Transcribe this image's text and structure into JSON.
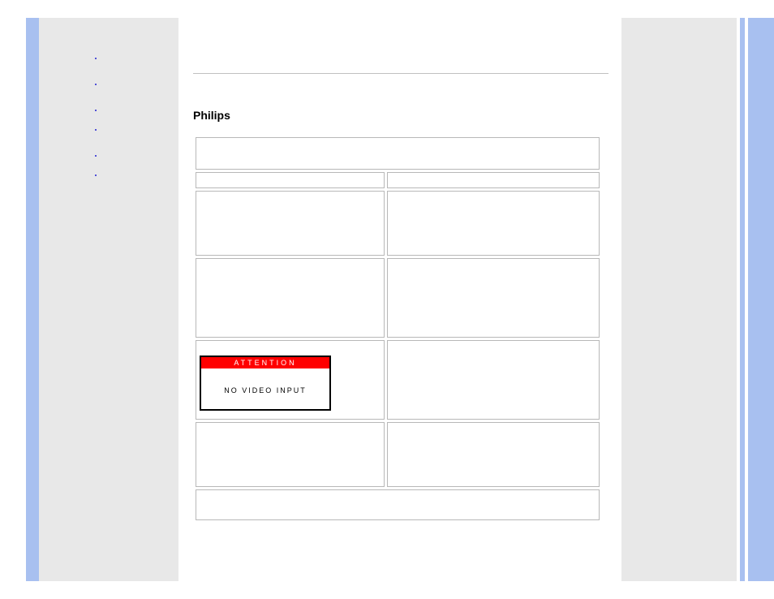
{
  "sidebar": {
    "items": [
      {
        "label": ""
      },
      {
        "label": ""
      },
      {
        "label": ""
      },
      {
        "label": ""
      },
      {
        "label": ""
      },
      {
        "label": ""
      }
    ]
  },
  "content": {
    "heading": "Philips",
    "attention": {
      "title": "ATTENTION",
      "message": "NO VIDEO INPUT"
    }
  }
}
